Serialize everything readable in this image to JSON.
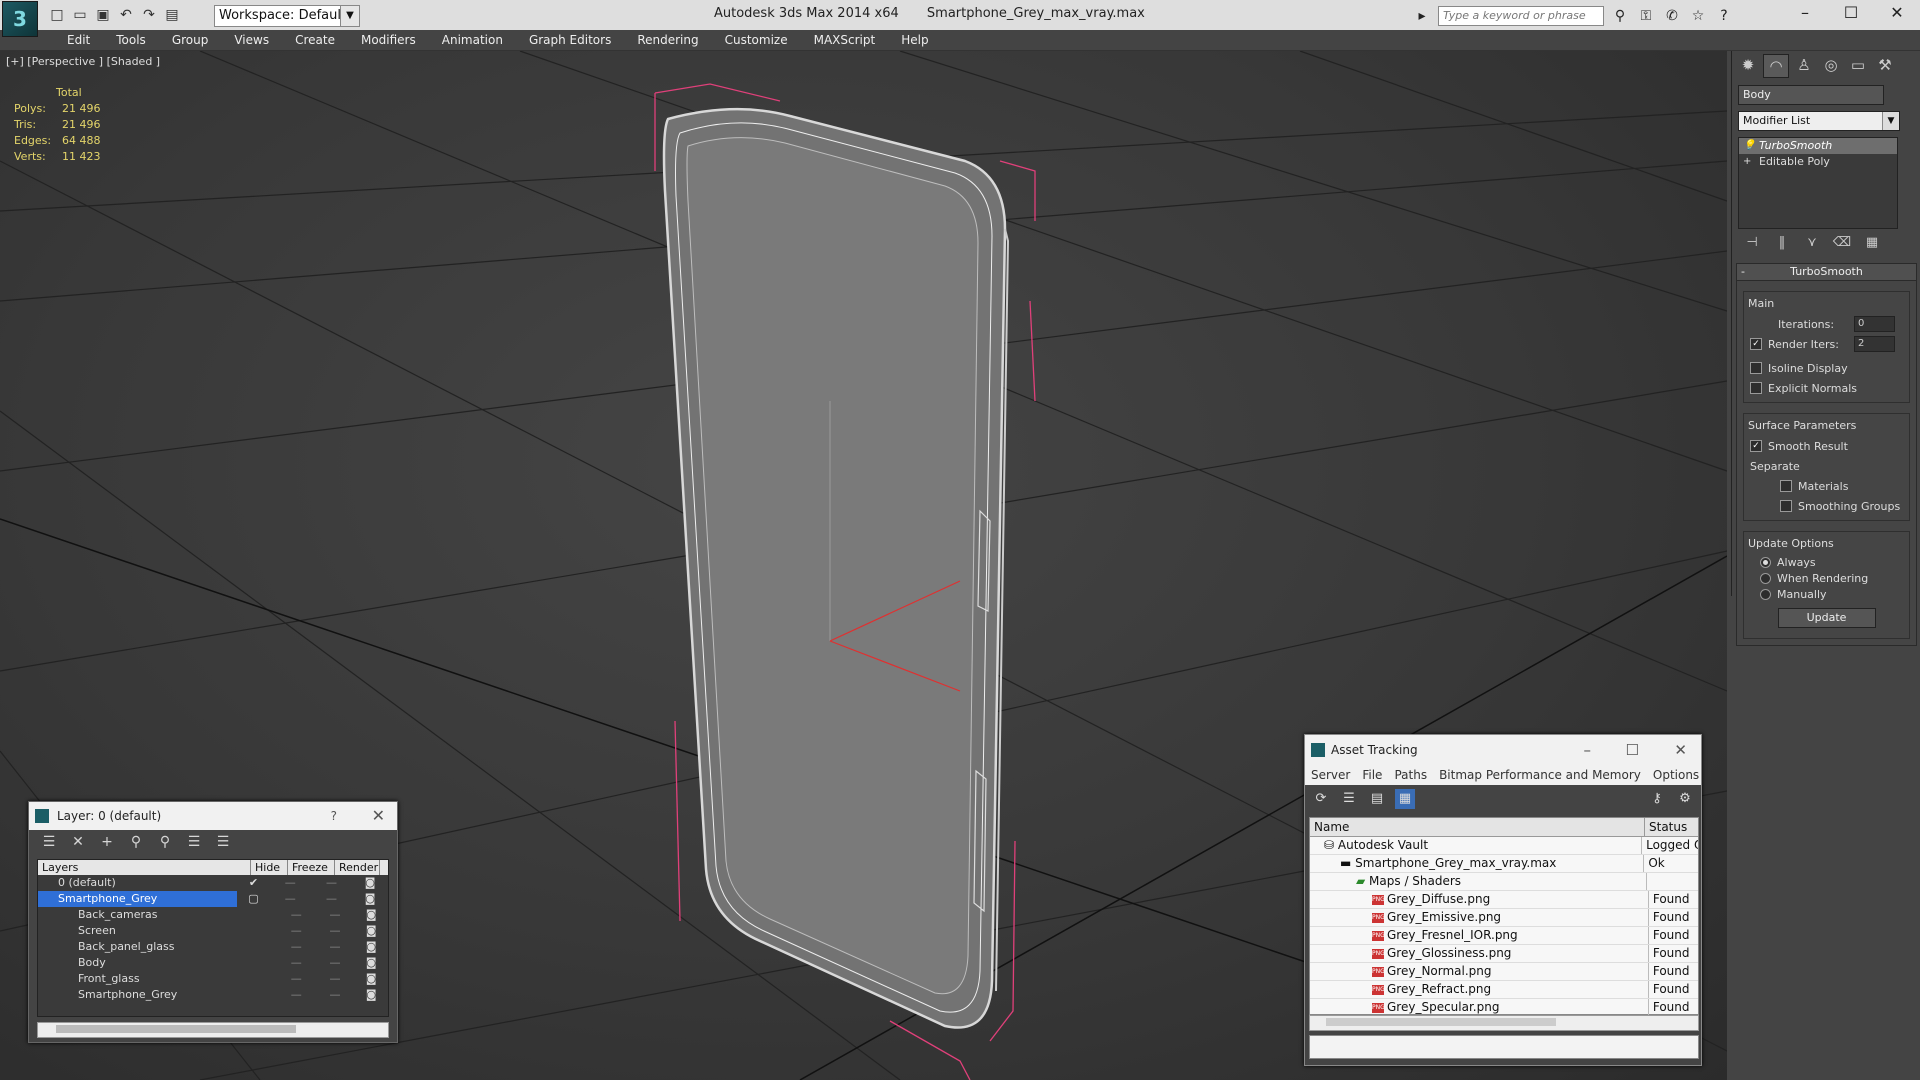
{
  "app": {
    "title": "Autodesk 3ds Max  2014 x64",
    "file": "Smartphone_Grey_max_vray.max",
    "workspace": "Workspace: Default",
    "search_placeholder": "Type a keyword or phrase"
  },
  "menu": [
    "Edit",
    "Tools",
    "Group",
    "Views",
    "Create",
    "Modifiers",
    "Animation",
    "Graph Editors",
    "Rendering",
    "Customize",
    "MAXScript",
    "Help"
  ],
  "viewport": {
    "label": "[+] [Perspective ] [Shaded ]",
    "stats_header": "Total",
    "stats": [
      {
        "k": "Polys:",
        "v": "21 496"
      },
      {
        "k": "Tris:",
        "v": "21 496"
      },
      {
        "k": "Edges:",
        "v": "64 488"
      },
      {
        "k": "Verts:",
        "v": "11 423"
      }
    ]
  },
  "command_panel": {
    "object_name": "Body",
    "modifier_list": "Modifier List",
    "stack": [
      "TurboSmooth",
      "Editable Poly"
    ],
    "rollout_title": "TurboSmooth",
    "main_label": "Main",
    "iterations_label": "Iterations:",
    "iterations_value": "0",
    "render_iters_label": "Render Iters:",
    "render_iters_value": "2",
    "isoline": "Isoline Display",
    "explicit_normals": "Explicit Normals",
    "surface_params": "Surface Parameters",
    "smooth_result": "Smooth Result",
    "separate": "Separate",
    "materials": "Materials",
    "smoothing_groups": "Smoothing Groups",
    "update_options": "Update Options",
    "always": "Always",
    "when_rendering": "When Rendering",
    "manually": "Manually",
    "update": "Update"
  },
  "layer_window": {
    "title": "Layer: 0 (default)",
    "help": "?",
    "columns": [
      "Layers",
      "Hide",
      "Freeze",
      "Render"
    ],
    "rows": [
      {
        "name": "0 (default)",
        "level": 0
      },
      {
        "name": "Smartphone_Grey",
        "level": 0
      },
      {
        "name": "Back_cameras",
        "level": 1
      },
      {
        "name": "Screen",
        "level": 1
      },
      {
        "name": "Back_panel_glass",
        "level": 1
      },
      {
        "name": "Body",
        "level": 1
      },
      {
        "name": "Front_glass",
        "level": 1
      },
      {
        "name": "Smartphone_Grey",
        "level": 1
      }
    ]
  },
  "asset_window": {
    "title": "Asset Tracking",
    "menu": [
      "Server",
      "File",
      "Paths",
      "Bitmap Performance and Memory",
      "Options"
    ],
    "columns": [
      "Name",
      "Status"
    ],
    "rows": [
      {
        "name": "Autodesk Vault",
        "status": "Logged O",
        "level": 0
      },
      {
        "name": "Smartphone_Grey_max_vray.max",
        "status": "Ok",
        "level": 1
      },
      {
        "name": "Maps / Shaders",
        "status": "",
        "level": 2
      },
      {
        "name": "Grey_Diffuse.png",
        "status": "Found",
        "level": 3
      },
      {
        "name": "Grey_Emissive.png",
        "status": "Found",
        "level": 3
      },
      {
        "name": "Grey_Fresnel_IOR.png",
        "status": "Found",
        "level": 3
      },
      {
        "name": "Grey_Glossiness.png",
        "status": "Found",
        "level": 3
      },
      {
        "name": "Grey_Normal.png",
        "status": "Found",
        "level": 3
      },
      {
        "name": "Grey_Refract.png",
        "status": "Found",
        "level": 3
      },
      {
        "name": "Grey_Specular.png",
        "status": "Found",
        "level": 3
      }
    ]
  }
}
